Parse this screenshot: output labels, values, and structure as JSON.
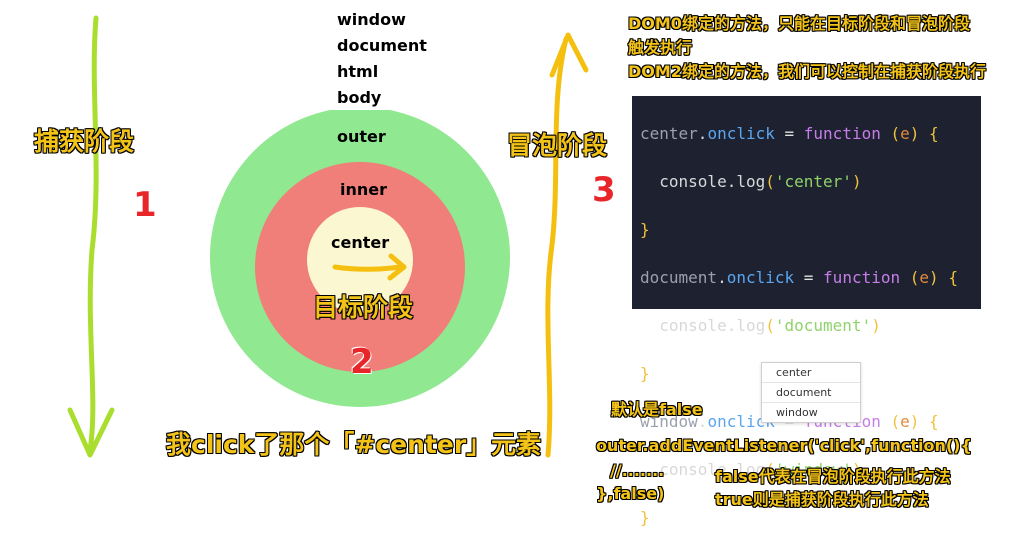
{
  "left": {
    "phase_label": "捕获阶段",
    "number": "1"
  },
  "right": {
    "phase_label": "冒泡阶段",
    "number": "3"
  },
  "dom_chain": [
    "window",
    "document",
    "html",
    "body"
  ],
  "circles": {
    "outer_label": "outer",
    "inner_label": "inner",
    "center_label": "center",
    "target_phase_label": "目标阶段",
    "target_number": "2"
  },
  "bottom_caption": "我click了那个「#center」元素",
  "notes": {
    "line1": "DOM0绑定的方法，只能在目标阶段和冒泡阶段",
    "line2": "触发执行",
    "line3": "DOM2绑定的方法，我们可以控制在捕获阶段执行"
  },
  "console_output": [
    "center",
    "document",
    "window"
  ],
  "bottom_notes": {
    "default": "默认是false",
    "code_line1": "outer.addEventListener('click',function(){",
    "code_line2": "//.......",
    "code_line3": "},false)",
    "false_desc": "false代表在冒泡阶段执行此方法",
    "true_desc": "true则是捕获阶段执行此方法"
  },
  "colors": {
    "outer_circle": "#90e890",
    "inner_circle": "#ef7f78",
    "center_circle": "#fbf7d0",
    "capture_arrow": "#a9de2e",
    "bubble_arrow": "#f5bf10",
    "label_yellow": "#f3c318"
  }
}
